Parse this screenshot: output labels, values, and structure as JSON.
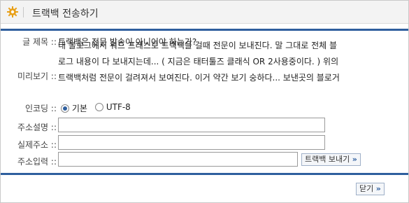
{
  "window": {
    "title": "트랙백 전송하기",
    "icon": "gear-icon",
    "accent": "#2f5f9e"
  },
  "form": {
    "subject_label": "글 제목 ::",
    "subject_value": "트랙백은 전문 발송이 아니어야 하는가?",
    "preview_label": "미리보기 ::",
    "preview_lines": [
      "내 블로그에서 워드 프레스로 트랙백을 걸때 전문이 보내진다. 말 그대로 전체 블",
      "로그 내용이 다 보내지는데... ( 지금은 태터툴즈 클래식 OR 2사용중이다. ) 위의",
      "트랙백처럼 전문이 걸려져서 보여진다. 이거 약간 보기 숭하다... 보낸곳의 블로거"
    ],
    "encoding_label": "인코딩 ::",
    "encoding_options": [
      "기본",
      "UTF-8"
    ],
    "encoding_selected": "기본",
    "addr_desc_label": "주소설명 ::",
    "addr_desc_value": "",
    "real_addr_label": "실제주소 ::",
    "real_addr_value": "",
    "addr_input_label": "주소입력 ::",
    "addr_input_value": ""
  },
  "buttons": {
    "send_label": "트랙백 보내기",
    "close_label": "닫기",
    "arrow": "»"
  }
}
